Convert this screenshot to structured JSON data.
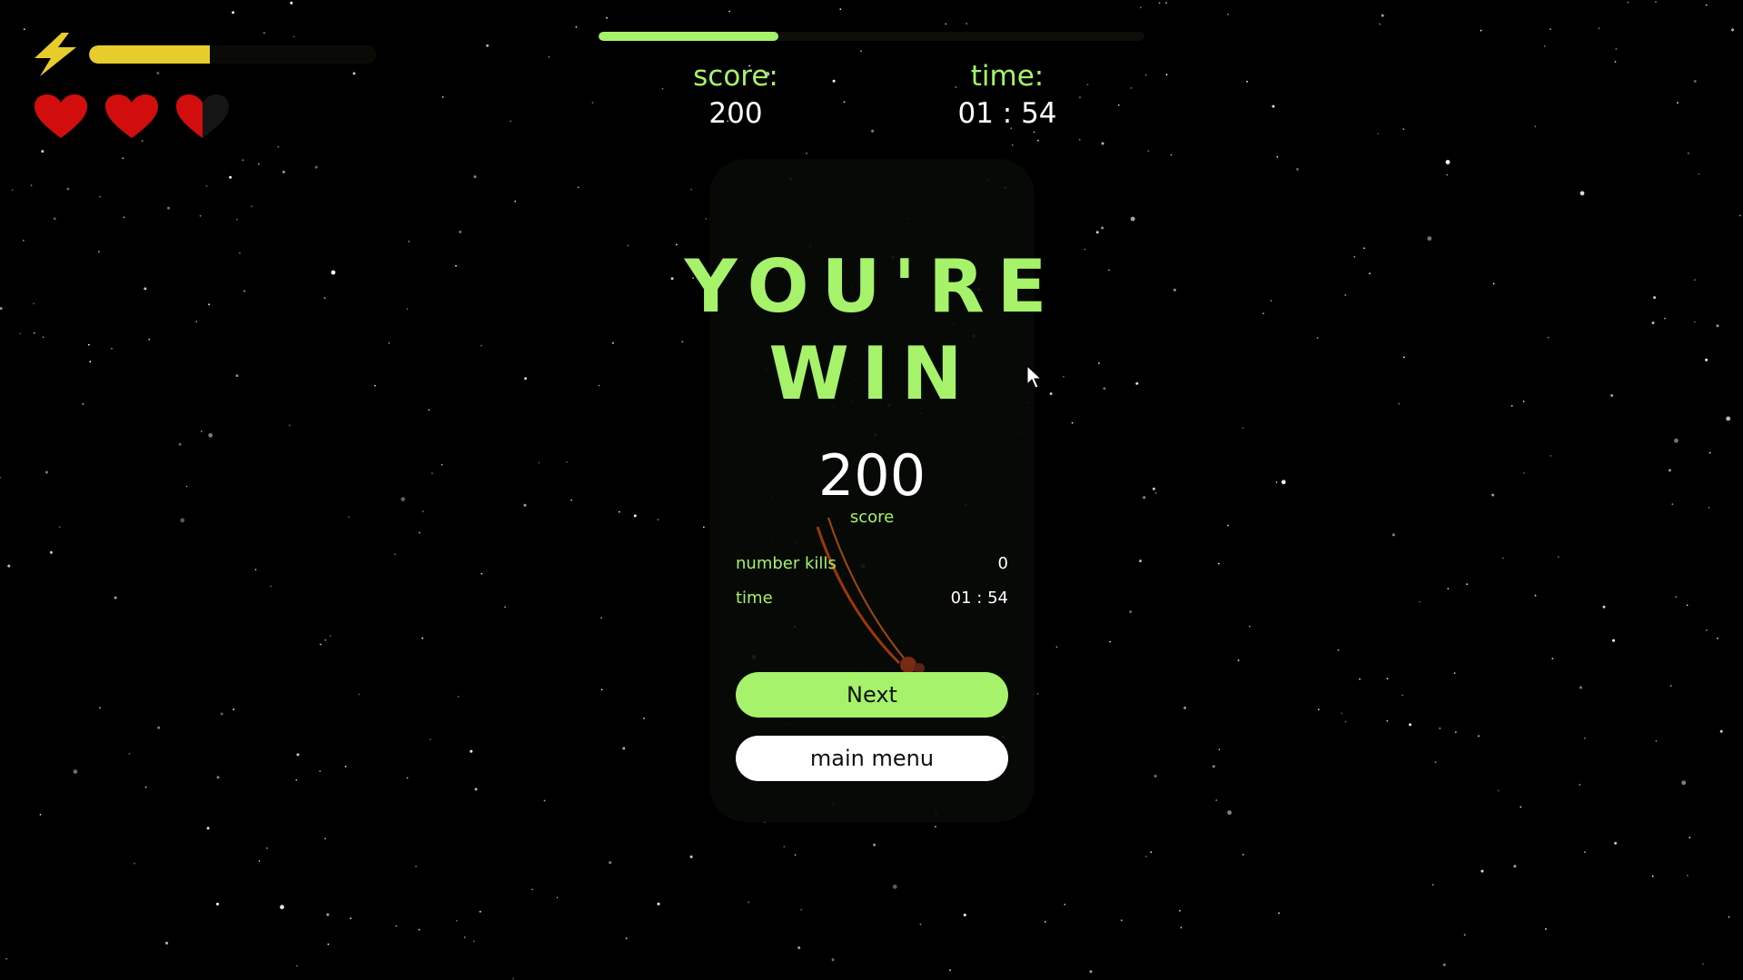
{
  "hud": {
    "energy_level": 0.42,
    "lives": {
      "max": 3,
      "current": 2.5
    },
    "level_progress": 0.33,
    "score_label": "score:",
    "score_value": "200",
    "time_label": "time:",
    "time_value": "01 : 54"
  },
  "win_panel": {
    "title_line1": "YOU'RE",
    "title_line2": "WIN",
    "score_value": "200",
    "score_label": "score",
    "stats": [
      {
        "label": "number kills",
        "value": "0"
      },
      {
        "label": "time",
        "value": "01 : 54"
      }
    ],
    "next_button": "Next",
    "menu_button": "main menu"
  },
  "colors": {
    "accent_green": "#a6f26a",
    "energy_yellow": "#e6cd2b",
    "heart_red": "#d10d0d",
    "background": "#000000"
  },
  "icons": [
    "lightning-icon",
    "heart-icon",
    "cursor-icon"
  ]
}
